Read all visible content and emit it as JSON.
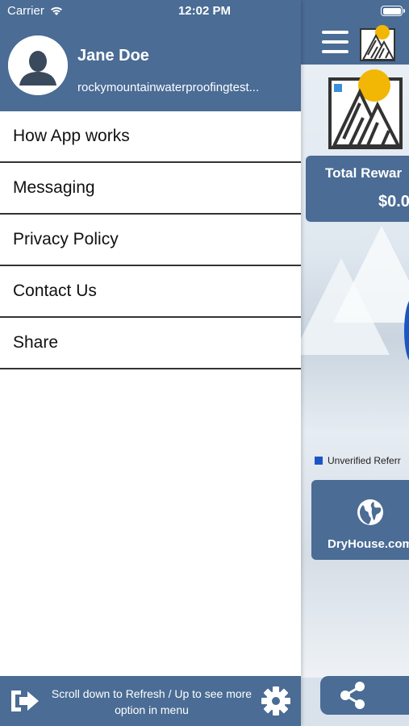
{
  "status_bar": {
    "carrier": "Carrier",
    "time": "12:02 PM"
  },
  "drawer": {
    "user": {
      "name": "Jane Doe",
      "email": "rockymountainwaterproofingtest..."
    },
    "menu": [
      {
        "label": "How App works"
      },
      {
        "label": "Messaging"
      },
      {
        "label": "Privacy Policy"
      },
      {
        "label": "Contact Us"
      },
      {
        "label": "Share"
      }
    ],
    "footer": {
      "text": "Scroll down to Refresh / Up to see more option in menu"
    }
  },
  "main": {
    "reward_title": "Total Rewar",
    "reward_value": "$0.0",
    "legend_label": "Unverified Referr",
    "website_label": "DryHouse.com"
  },
  "colors": {
    "brand": "#4a6c95",
    "series": "#1b56c4"
  }
}
